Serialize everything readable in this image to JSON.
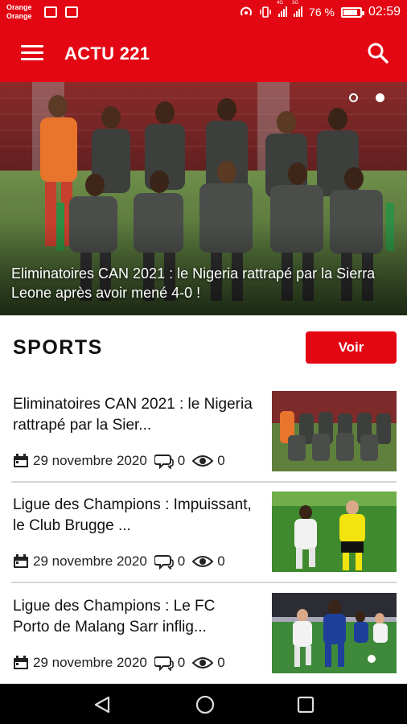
{
  "status_bar": {
    "carrier_line1": "Orange",
    "carrier_line2": "Orange",
    "signal1_label": "4G",
    "signal2_label": "3G",
    "battery": "76 %",
    "time": "02:59"
  },
  "app_bar": {
    "title": "ACTU 221",
    "menu_icon": "hamburger-menu-icon",
    "search_icon": "search-icon"
  },
  "hero": {
    "caption": "Eliminatoires CAN 2021 : le Nigeria rattrapé par la Sierra Leone après avoir mené 4-0 !",
    "slides": 2,
    "active_slide": 2
  },
  "section": {
    "title": "SPORTS",
    "voir_label": "Voir"
  },
  "articles": [
    {
      "title": "Eliminatoires CAN 2021 : le Nigeria rattrapé par la Sier...",
      "date": "29 novembre 2020",
      "comments": "0",
      "views": "0"
    },
    {
      "title": "Ligue des Champions : Impuissant, le Club Brugge ...",
      "date": "29 novembre 2020",
      "comments": "0",
      "views": "0"
    },
    {
      "title": "Ligue des Champions : Le FC Porto de Malang Sarr inflig...",
      "date": "29 novembre 2020",
      "comments": "0",
      "views": "0"
    }
  ],
  "colors": {
    "brand_red": "#e30613",
    "text": "#111111",
    "divider": "#d6d6d6"
  },
  "nav": {
    "back_icon": "back-triangle-icon",
    "home_icon": "home-circle-icon",
    "recent_icon": "recent-apps-square-icon"
  }
}
